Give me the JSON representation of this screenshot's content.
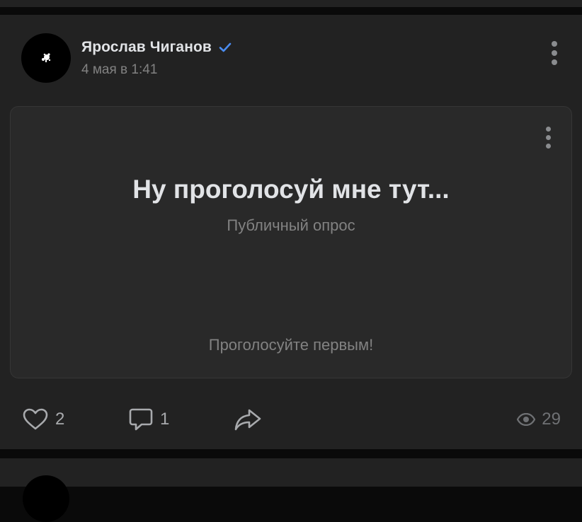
{
  "post": {
    "author": "Ярослав Чиганов",
    "verified": true,
    "date": "4 мая в 1:41",
    "poll": {
      "title": "Ну проголосуй мне тут...",
      "type": "Публичный опрос",
      "prompt": "Проголосуйте первым!"
    },
    "actions": {
      "likes": "2",
      "comments": "1",
      "views": "29"
    }
  },
  "icons": {
    "like": "heart-icon",
    "comment": "comment-icon",
    "share": "share-icon",
    "views": "eye-icon",
    "verified": "verified-check-icon",
    "menu": "more-vertical-icon"
  },
  "colors": {
    "background": "#0a0a0a",
    "card": "#222222",
    "poll_card": "#292929",
    "text_primary": "#e1e3e6",
    "text_secondary": "#828282",
    "accent_verified": "#4a8cf0"
  }
}
